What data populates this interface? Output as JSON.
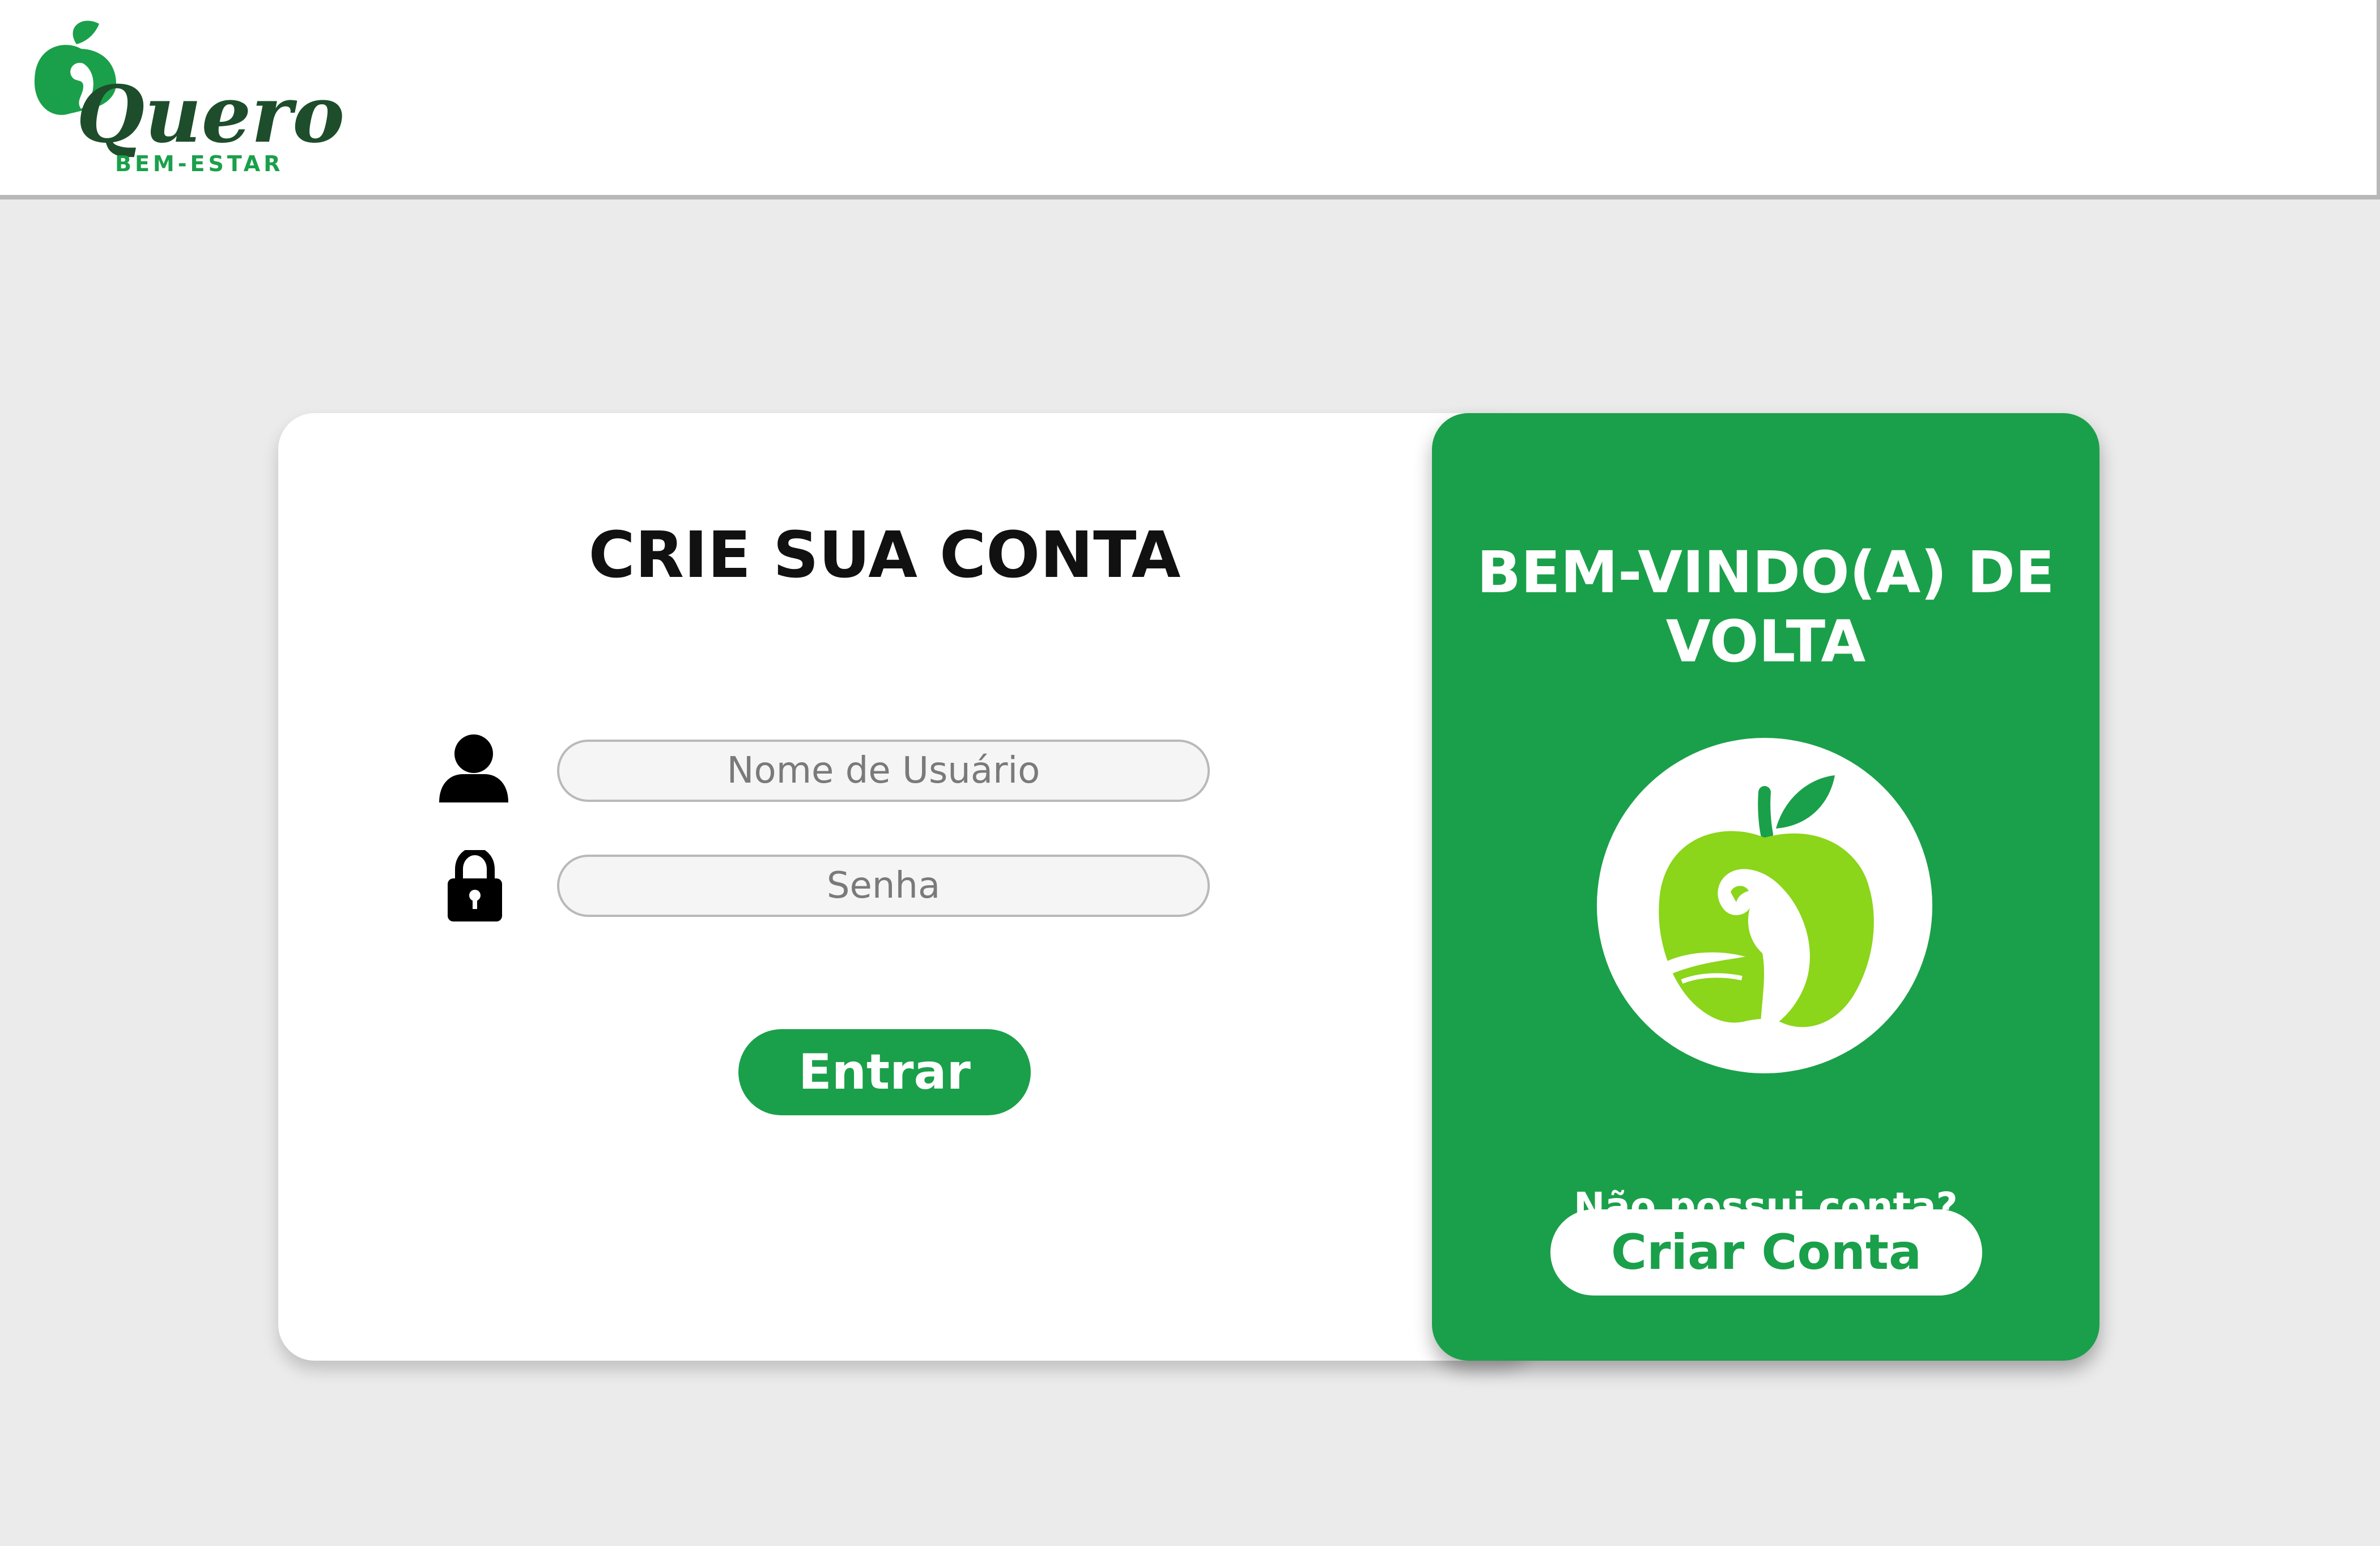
{
  "brand": {
    "logo_name": "Quero",
    "logo_tagline": "BEM-ESTAR",
    "colors": {
      "green": "#1aa04a",
      "dark_green": "#1e4d2b",
      "lime": "#8bd51a"
    }
  },
  "login": {
    "title": "CRIE SUA CONTA",
    "username_placeholder": "Nome de Usuário",
    "password_placeholder": "Senha",
    "submit_label": "Entrar",
    "icons": [
      "user-icon",
      "lock-icon"
    ]
  },
  "side_panel": {
    "title": "BEM-VINDO(A) DE VOLTA",
    "prompt": "Não possui conta?",
    "create_label": "Criar Conta",
    "emblem_icon": "apple-muscle-icon"
  }
}
